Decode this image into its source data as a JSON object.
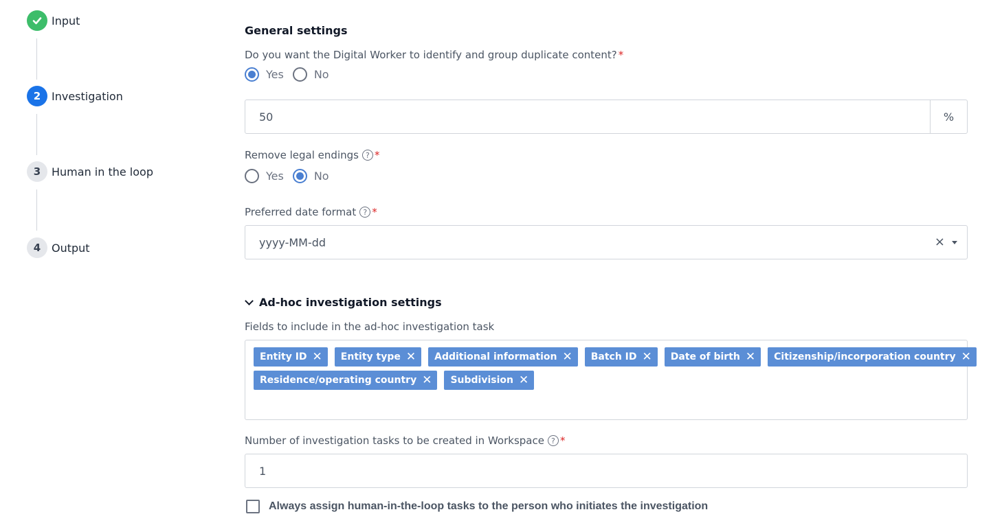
{
  "stepper": {
    "steps": [
      {
        "number": "",
        "label": "Input",
        "state": "done"
      },
      {
        "number": "2",
        "label": "Investigation",
        "state": "active"
      },
      {
        "number": "3",
        "label": "Human in the loop",
        "state": "pending"
      },
      {
        "number": "4",
        "label": "Output",
        "state": "pending"
      }
    ]
  },
  "general": {
    "title": "General settings",
    "duplicate_question": "Do you want the Digital Worker to identify and group duplicate content?",
    "required_mark": "*",
    "duplicate_options": {
      "yes": "Yes",
      "no": "No",
      "selected": "Yes"
    },
    "threshold_value": "50",
    "threshold_unit": "%",
    "legal_endings_label": "Remove legal endings",
    "legal_endings_options": {
      "yes": "Yes",
      "no": "No",
      "selected": "No"
    },
    "date_format_label": "Preferred date format",
    "date_format_value": "yyyy-MM-dd",
    "help_glyph": "?",
    "clear_glyph": "×"
  },
  "adhoc": {
    "title": "Ad-hoc investigation settings",
    "fields_label": "Fields to include in the ad-hoc investigation task",
    "tag_remove_glyph": "✕",
    "tags_row1": [
      "Entity ID",
      "Entity type",
      "Additional information",
      "Batch ID",
      "Date of birth",
      "Citizenship/incorporation country"
    ],
    "tags_row2": [
      "Residence/operating country",
      "Subdivision"
    ],
    "tasks_label": "Number of investigation tasks to be created in Workspace",
    "tasks_value": "1",
    "assign_checkbox_label": "Always assign human-in-the-loop tasks to the person who initiates the investigation",
    "assign_checked": false
  },
  "colors": {
    "accent": "#4a7fd1",
    "tag": "#5b8ed6",
    "done": "#3dbd6a",
    "active_step": "#1a73e8",
    "required": "#dc2626"
  }
}
